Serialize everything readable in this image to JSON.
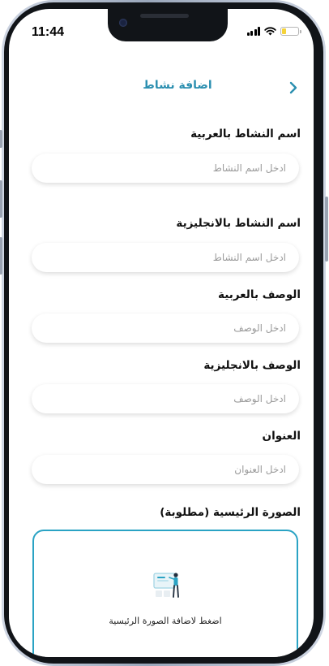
{
  "status_bar": {
    "time": "11:44"
  },
  "header": {
    "title": "اضافة نشاط",
    "back_icon": "chevron-right-icon"
  },
  "fields": [
    {
      "label": "اسم النشاط بالعربية",
      "placeholder": "ادخل اسم النشاط",
      "value": ""
    },
    {
      "label": "اسم النشاط بالانجليزية",
      "placeholder": "ادخل اسم النشاط",
      "value": ""
    },
    {
      "label": "الوصف بالعربية",
      "placeholder": "ادخل الوصف",
      "value": ""
    },
    {
      "label": "الوصف بالانجليزية",
      "placeholder": "ادخل الوصف",
      "value": ""
    },
    {
      "label": "العنوان",
      "placeholder": "ادخل العنوان",
      "value": ""
    }
  ],
  "main_image": {
    "label": "الصورة الرئيسية (مطلوبة)",
    "upload_hint": "اضغط لاضافة الصورة الرئيسية"
  },
  "colors": {
    "accent": "#2b8fb0",
    "upload_border": "#2aa3c4",
    "battery": "#f5d33a"
  }
}
